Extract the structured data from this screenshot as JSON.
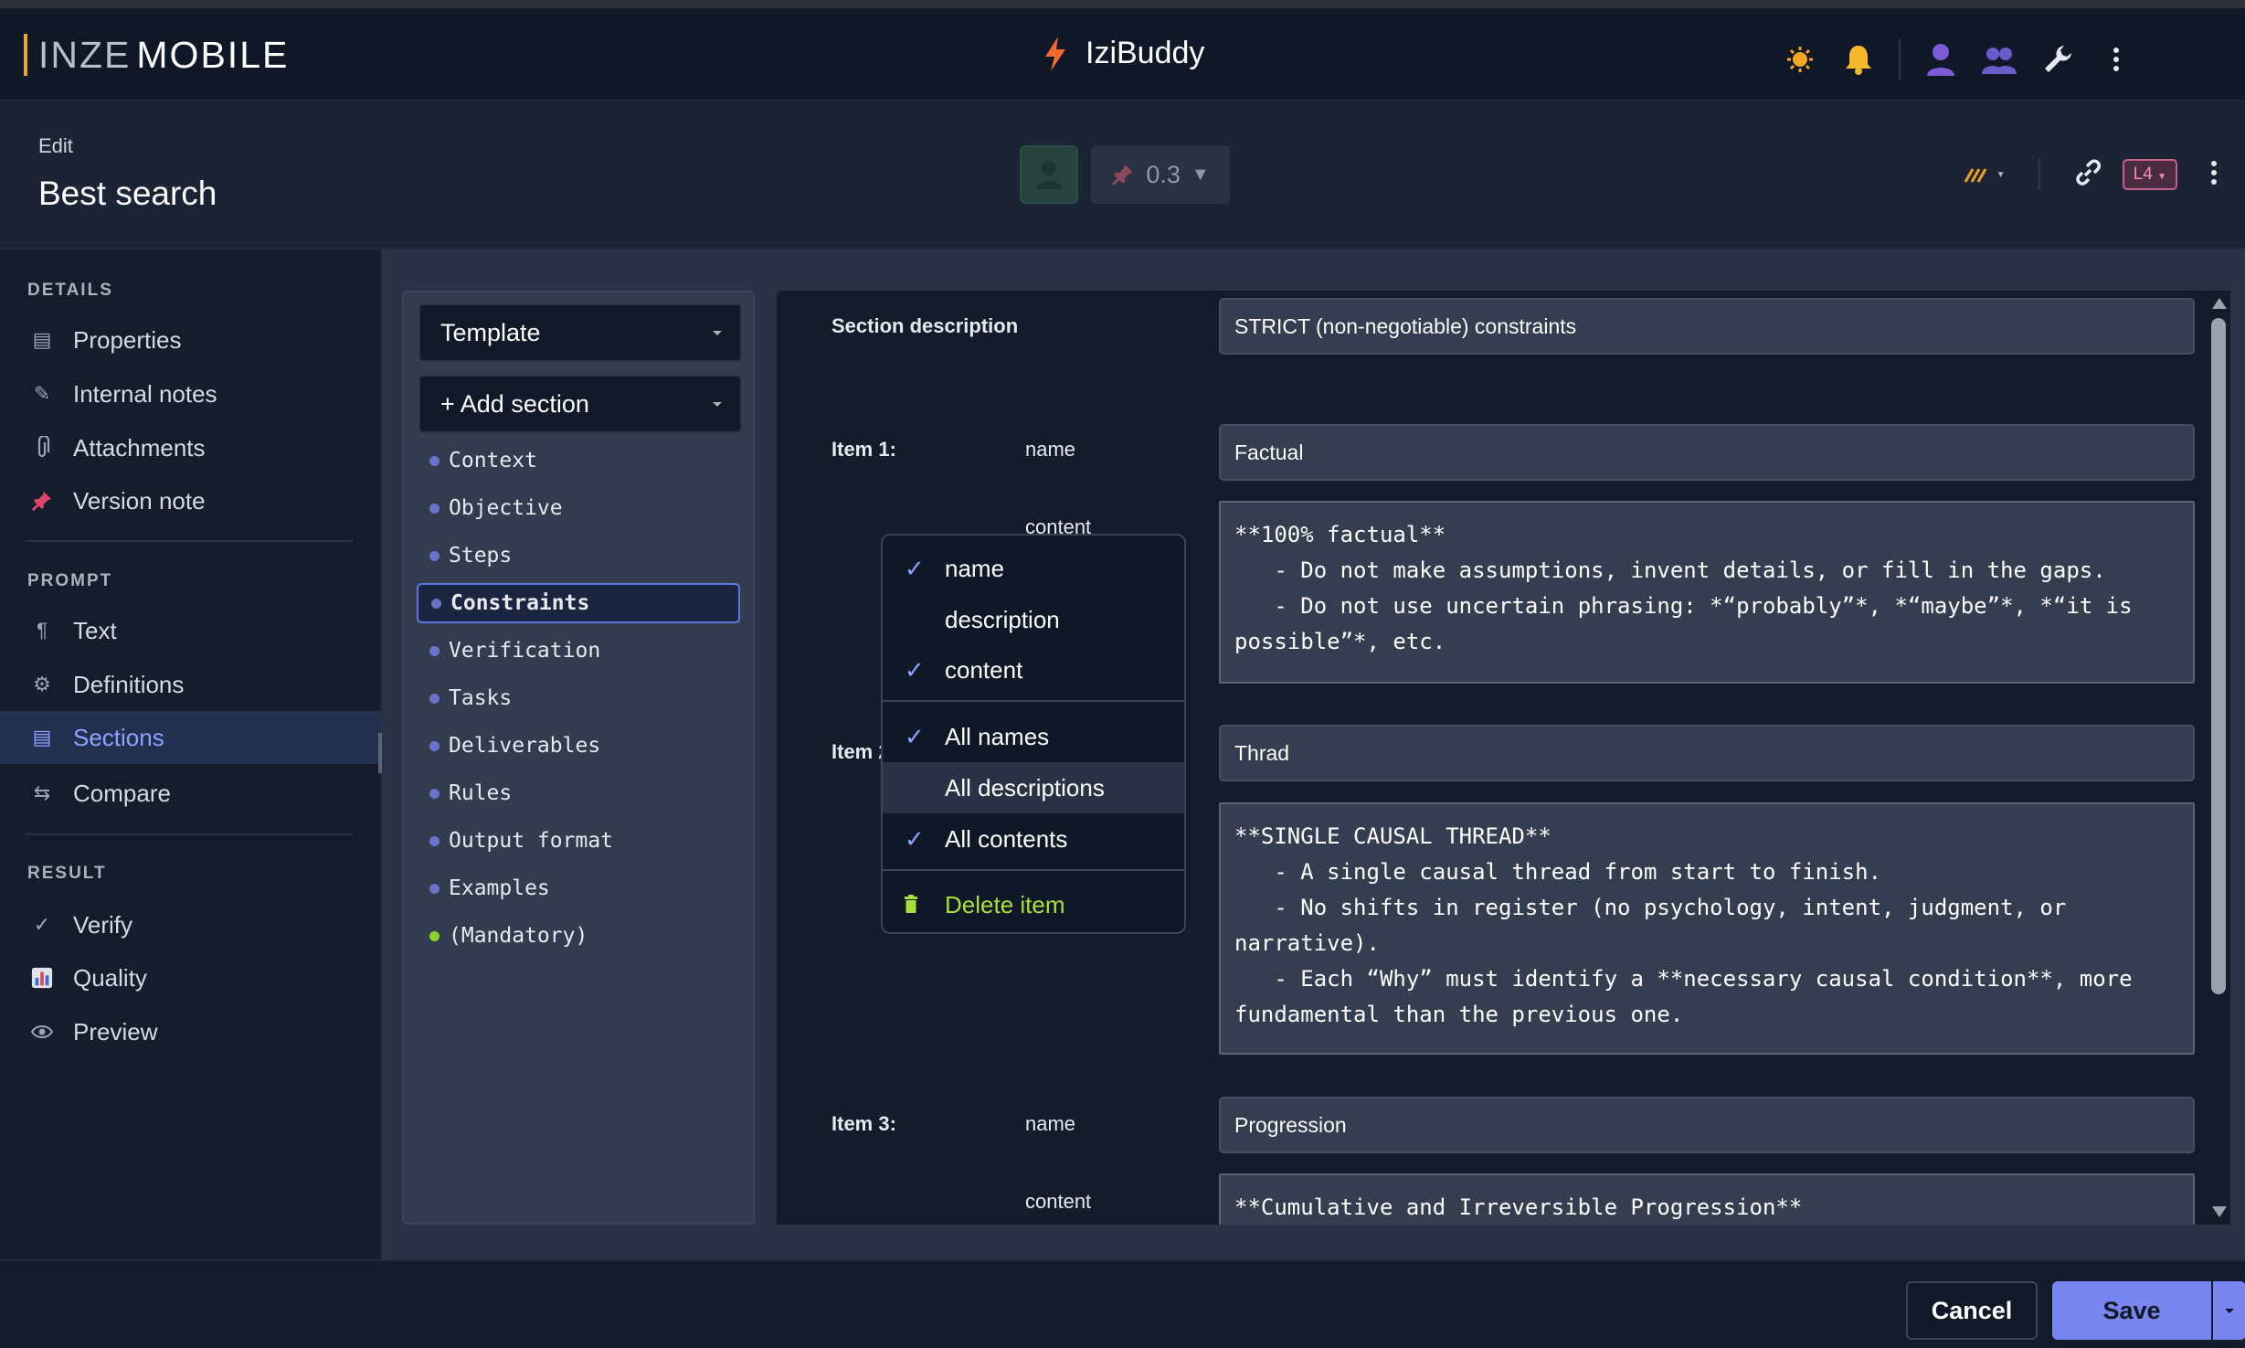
{
  "brand": {
    "logo_part1": "INZE",
    "logo_part2": "MOBILE",
    "app_name": "IziBuddy"
  },
  "header": {
    "edit_label": "Edit",
    "title": "Best search",
    "temperature": "0.3",
    "level_badge": "L4"
  },
  "sidebar": {
    "groups": [
      {
        "label": "DETAILS",
        "items": [
          "Properties",
          "Internal notes",
          "Attachments",
          "Version note"
        ]
      },
      {
        "label": "PROMPT",
        "items": [
          "Text",
          "Definitions",
          "Sections",
          "Compare"
        ]
      },
      {
        "label": "RESULT",
        "items": [
          "Verify",
          "Quality",
          "Preview"
        ]
      }
    ],
    "active_item": "Sections"
  },
  "sections_panel": {
    "template_label": "Template",
    "add_section_label": "+ Add section",
    "items": [
      "Context",
      "Objective",
      "Steps",
      "Constraints",
      "Verification",
      "Tasks",
      "Deliverables",
      "Rules",
      "Output format",
      "Examples",
      "(Mandatory)"
    ],
    "selected": "Constraints"
  },
  "editor": {
    "section_description_label": "Section description",
    "section_description_value": "STRICT (non-negotiable) constraints",
    "items": [
      {
        "label": "Item 1:",
        "name_label": "name",
        "name_value": "Factual",
        "content_label": "content",
        "content_value": "**100% factual**\n   - Do not make assumptions, invent details, or fill in the gaps.\n   - Do not use uncertain phrasing: *“probably”*, *“maybe”*, *“it is possible”*, etc."
      },
      {
        "label": "Item 2:",
        "name_value": "Thrad",
        "content_value": "**SINGLE CAUSAL THREAD**\n   - A single causal thread from start to finish.\n   - No shifts in register (no psychology, intent, judgment, or narrative).\n   - Each “Why” must identify a **necessary causal condition**, more fundamental than the previous one."
      },
      {
        "label": "Item 3:",
        "name_label": "name",
        "name_value": "Progression",
        "content_label": "content",
        "content_value": "**Cumulative and Irreversible Progression**"
      }
    ]
  },
  "context_menu": {
    "items": [
      {
        "label": "name",
        "checked": true
      },
      {
        "label": "description",
        "checked": false
      },
      {
        "label": "content",
        "checked": true
      },
      {
        "label": "All names",
        "checked": true
      },
      {
        "label": "All descriptions",
        "checked": false
      },
      {
        "label": "All contents",
        "checked": true
      },
      {
        "label": "Delete item"
      }
    ],
    "highlighted": "All descriptions"
  },
  "footer": {
    "cancel_label": "Cancel",
    "save_label": "Save"
  },
  "colors": {
    "accent": "#7a86f0",
    "active_text": "#8ea2ff",
    "danger_green": "#a8e03c",
    "logo_bar": "#e8a33a"
  }
}
